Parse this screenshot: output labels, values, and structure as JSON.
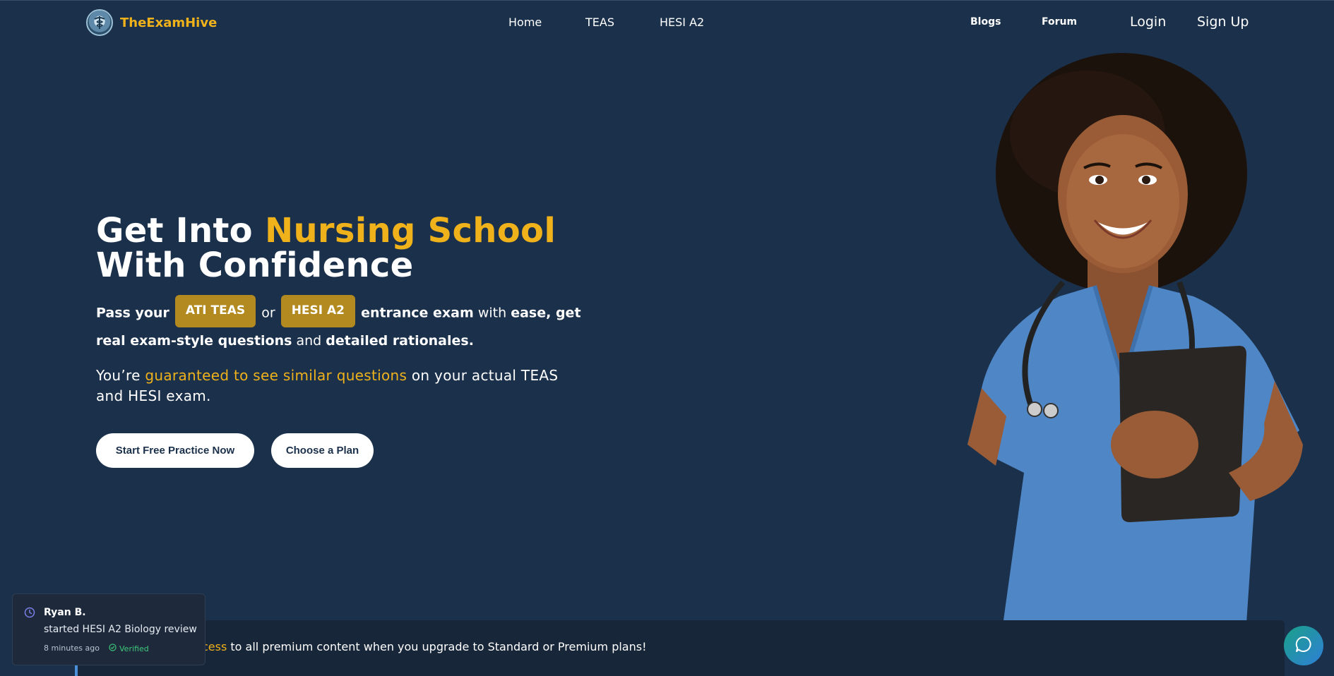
{
  "nav": {
    "brand": "TheExamHive",
    "links": [
      "Home",
      "TEAS",
      "HESI A2"
    ],
    "blogs": "Blogs",
    "forum": "Forum",
    "login": "Login",
    "signup": "Sign Up"
  },
  "hero": {
    "title_part1": "Get Into ",
    "title_accent": "Nursing School",
    "title_part2": "With Confidence",
    "sub_pass": "Pass your",
    "pill_teas": "ATI TEAS",
    "sub_or": "or",
    "pill_hesi": "HESI A2",
    "sub_entrance": "entrance exam",
    "sub_with": "with",
    "sub_ease": "ease, get real exam-style questions",
    "sub_and": "and",
    "sub_rationales": "detailed rationales.",
    "guarantee_pre": "You’re ",
    "guarantee_accent": "guaranteed to see similar questions",
    "guarantee_post": " on your actual TEAS and HESI exam.",
    "btn_free": "Start Free Practice Now",
    "btn_plan": "Choose a Plan"
  },
  "banner": {
    "accent": "cess",
    "text": " to all premium content when you upgrade to Standard or Premium plans!"
  },
  "toast": {
    "name": "Ryan B.",
    "action": "started HESI A2 Biology review",
    "time": "8 minutes ago",
    "verified": "Verified"
  },
  "colors": {
    "background": "#1b304b",
    "accent": "#f0b21b",
    "pill": "#b28a1f",
    "verified": "#3ec97a"
  }
}
